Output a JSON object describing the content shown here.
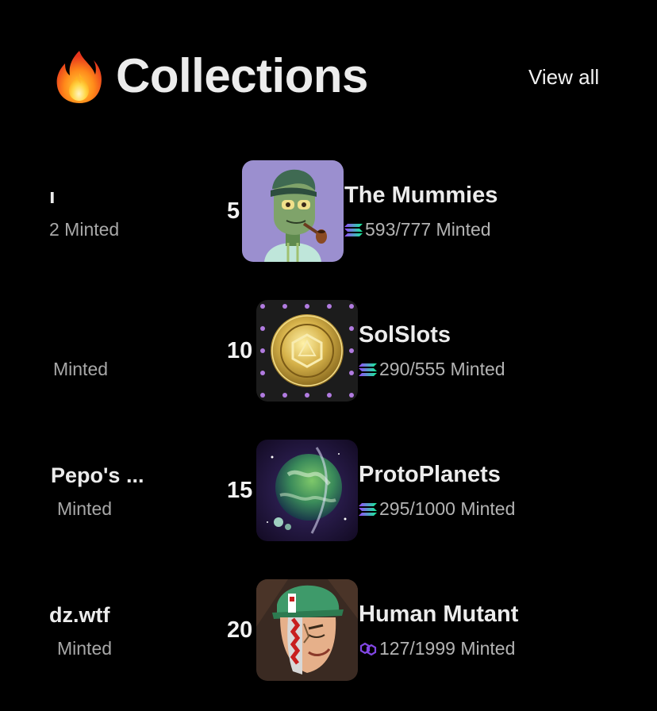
{
  "header": {
    "icon": "fire-icon",
    "title": "Collections",
    "view_all_label": "View all"
  },
  "left_column": [
    {
      "name": "ı",
      "minted": "2 Minted"
    },
    {
      "name": "",
      "minted": "Minted"
    },
    {
      "name": "Pepo's ...",
      "minted": "Minted"
    },
    {
      "name": "dz.wtf",
      "minted": "Minted"
    }
  ],
  "collections": [
    {
      "rank": "5",
      "name": "The Mummies",
      "minted": "593/777 Minted",
      "chain": "solana",
      "chain_icon": "solana-icon",
      "thumb_bg": "#9b8fcf"
    },
    {
      "rank": "10",
      "name": "SolSlots",
      "minted": "290/555 Minted",
      "chain": "solana",
      "chain_icon": "solana-icon",
      "thumb_bg": "#1c1c1c"
    },
    {
      "rank": "15",
      "name": "ProtoPlanets",
      "minted": "295/1000 Minted",
      "chain": "solana",
      "chain_icon": "solana-icon",
      "thumb_bg": "#1b1234"
    },
    {
      "rank": "20",
      "name": "Human Mutant",
      "minted": "127/1999 Minted",
      "chain": "polygon",
      "chain_icon": "polygon-icon",
      "thumb_bg": "#3a2a22"
    }
  ],
  "colors": {
    "background": "#000000",
    "text": "#ececec",
    "muted": "#a8a8a8",
    "polygon": "#8247e5"
  }
}
